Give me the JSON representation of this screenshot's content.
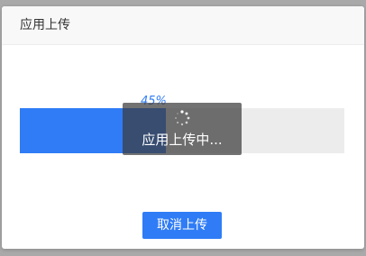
{
  "dialog": {
    "title": "应用上传"
  },
  "progress": {
    "percent_label": "45%",
    "value": 0.45,
    "fill_color": "#2f7cf6",
    "track_color": "#ececec"
  },
  "loading": {
    "text": "应用上传中...",
    "icon": "spinner-icon"
  },
  "actions": {
    "cancel_label": "取消上传",
    "accent_color": "#2f7cf6"
  }
}
